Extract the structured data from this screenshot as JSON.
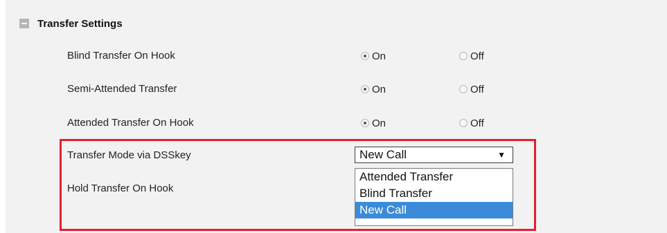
{
  "section": {
    "title": "Transfer Settings",
    "icon": "collapse-icon"
  },
  "rows": [
    {
      "label": "Blind Transfer On Hook",
      "on_label": "On",
      "off_label": "Off",
      "value": "On"
    },
    {
      "label": "Semi-Attended Transfer",
      "on_label": "On",
      "off_label": "Off",
      "value": "On"
    },
    {
      "label": "Attended Transfer On Hook",
      "on_label": "On",
      "off_label": "Off",
      "value": "On"
    }
  ],
  "transfer_mode": {
    "label": "Transfer Mode via DSSkey",
    "selected": "New Call",
    "options": [
      "Attended Transfer",
      "Blind Transfer",
      "New Call"
    ]
  },
  "hold_transfer": {
    "label": "Hold Transfer On Hook"
  },
  "colors": {
    "highlight": "#e2202c",
    "selected_option_bg": "#3b8bd8"
  }
}
